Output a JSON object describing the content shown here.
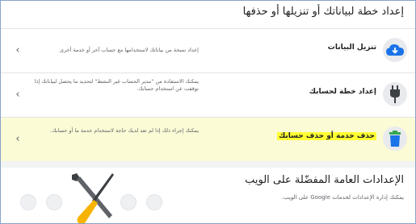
{
  "section": {
    "title": "إعداد خطة لبياناتك أو تنزيلها أو حذفها"
  },
  "rows": [
    {
      "title": "تنزيل البيانات",
      "description": "إعداد نسخة من بياناتك لاستخدامها مع حساب آخر أو خدمة أخرى",
      "icon": "cloud-download-icon"
    },
    {
      "title": "إعداد خطة لحسابك",
      "description": "يمكنك الاستفادة من \"مدير الحساب غير النشط\" لتحديد ما يحصل لبياناتك إذا توقفت عن استخدام حسابك.",
      "icon": "plug-icon"
    },
    {
      "title": "حذف خدمة أو حذف حسابك",
      "description": "يمكنك إجراء ذلك إذا لم تعد لديك حاجة لاستخدام خدمة ما أو حسابك.",
      "icon": "trash-icon"
    }
  ],
  "card": {
    "title": "الإعدادات العامة المفضّلة على الويب",
    "subtitle": "يمكنك إدارة الإعدادات لخدمات Google على الويب."
  },
  "colors": {
    "highlight_row": "#fbfbd6",
    "marker": "#ffff33",
    "cloud_blue": "#1a73e8",
    "wrench_yellow": "#f6b400"
  }
}
